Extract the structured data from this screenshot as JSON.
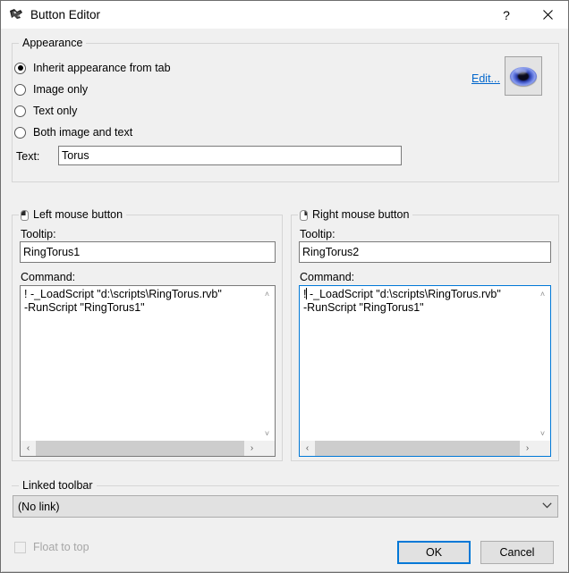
{
  "window": {
    "title": "Button Editor",
    "icon": "rhino-logo-icon",
    "help_label": "?",
    "close_label": "✕"
  },
  "appearance": {
    "group_label": "Appearance",
    "options": [
      {
        "label": "Inherit appearance from tab",
        "selected": true
      },
      {
        "label": "Image only",
        "selected": false
      },
      {
        "label": "Text only",
        "selected": false
      },
      {
        "label": "Both image and text",
        "selected": false
      }
    ],
    "text_label": "Text:",
    "text_value": "Torus",
    "text_placeholder": "",
    "edit_link": "Edit...",
    "preview_icon": "torus-icon"
  },
  "left_mouse": {
    "group_label": "Left mouse button",
    "mouse_icon": "mouse-left-button-icon",
    "tooltip_label": "Tooltip:",
    "tooltip_value": "RingTorus1",
    "command_label": "Command:",
    "command_value": "! -_LoadScript \"d:\\scripts\\RingTorus.rvb\"\n-RunScript \"RingTorus1\"",
    "focused": false,
    "scroll_up": "˄",
    "scroll_down": "˅",
    "scroll_left": "‹",
    "scroll_right": "›"
  },
  "right_mouse": {
    "group_label": "Right mouse button",
    "mouse_icon": "mouse-right-button-icon",
    "tooltip_label": "Tooltip:",
    "tooltip_value": "RingTorus2",
    "command_label": "Command:",
    "command_prefix": "!",
    "command_rest": " -_LoadScript \"d:\\scripts\\RingTorus.rvb\"\n-RunScript \"RingTorus1\"",
    "focused": true,
    "scroll_up": "˄",
    "scroll_down": "˅",
    "scroll_left": "‹",
    "scroll_right": "›"
  },
  "linked_toolbar": {
    "group_label": "Linked toolbar",
    "selected": "(No link)",
    "chevron": "⌄"
  },
  "footer": {
    "float_to_top_label": "Float to top",
    "float_to_top_checked": false,
    "float_to_top_disabled": true,
    "ok_label": "OK",
    "cancel_label": "Cancel"
  },
  "colors": {
    "dialog_bg": "#f0f0f0",
    "titlebar_bg": "#ffffff",
    "focus_blue": "#0078d7",
    "link_blue": "#0066cc",
    "field_bg": "#ffffff",
    "group_border": "#d5d5d5",
    "disabled_text": "#a6a6a6"
  }
}
